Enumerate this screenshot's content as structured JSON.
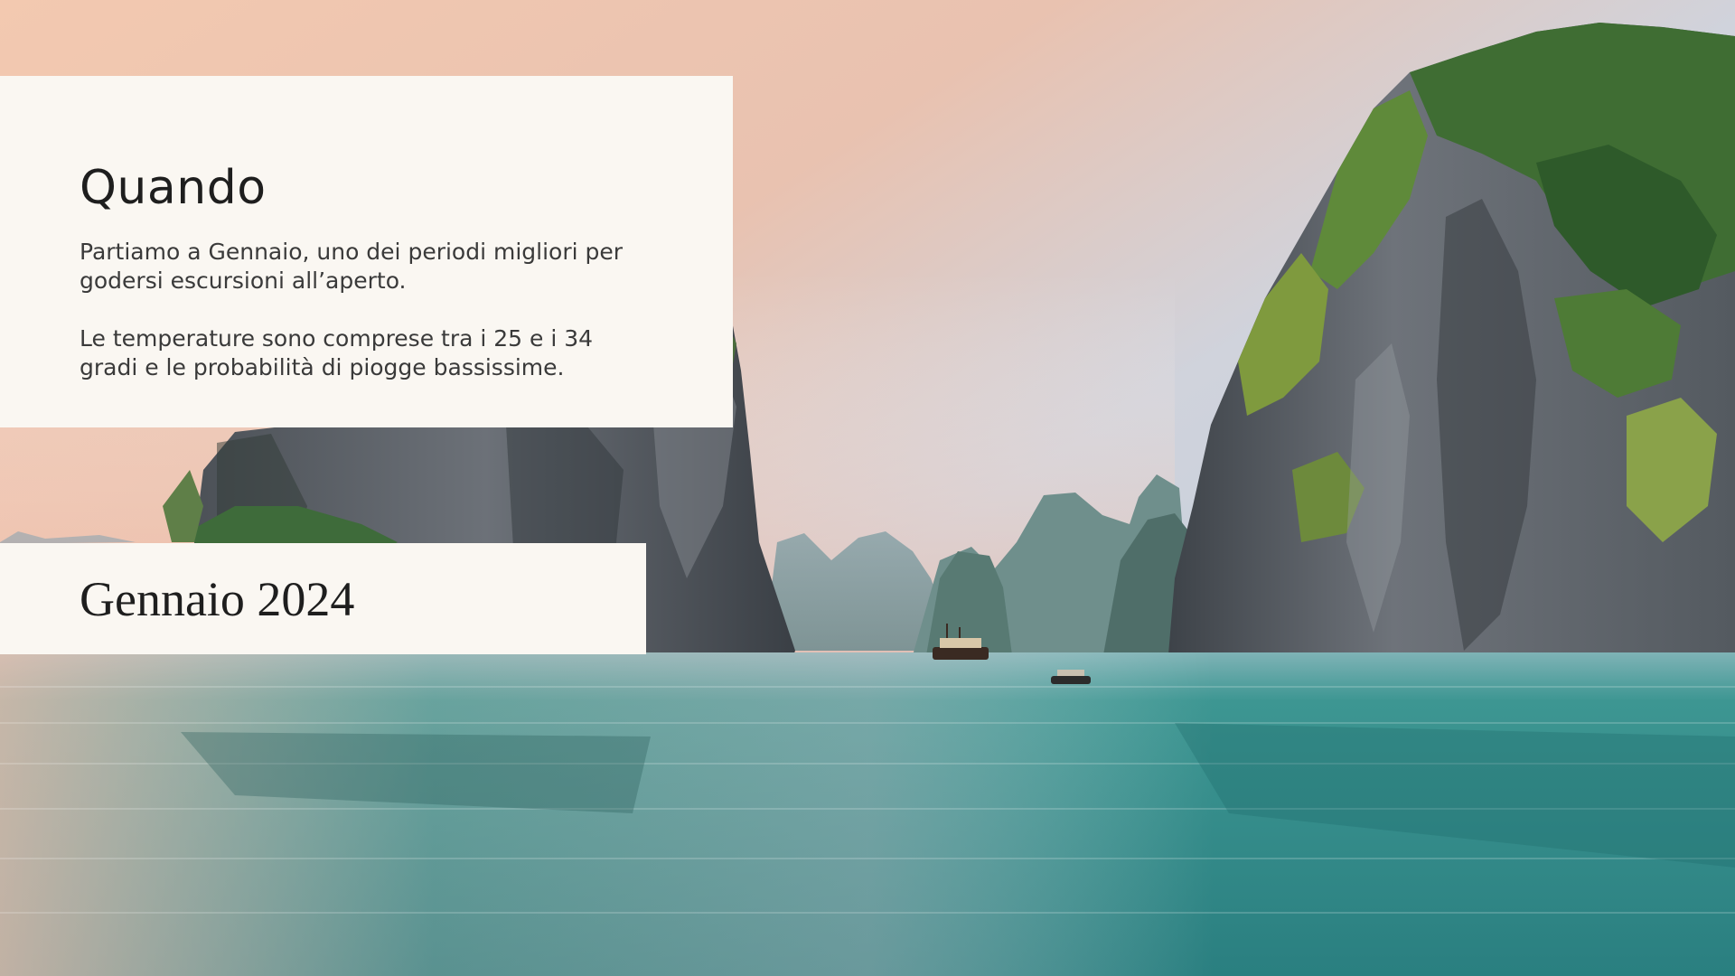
{
  "slide": {
    "title": "Quando",
    "paragraphs": [
      "Partiamo a Gennaio, uno dei periodi migliori per godersi escursioni all’aperto.",
      "Le temperature sono comprese tra i 25 e i 34 gradi e le probabilità di piogge bassissime."
    ],
    "date": "Gennaio 2024"
  },
  "colors": {
    "card_background": "#faf7f2",
    "text_dark": "#1e1e1e",
    "text_body": "#3a3a3a",
    "water": "#2f8f8a",
    "sky_warm": "#f0b79a",
    "sky_cool": "#c9d1dc"
  }
}
